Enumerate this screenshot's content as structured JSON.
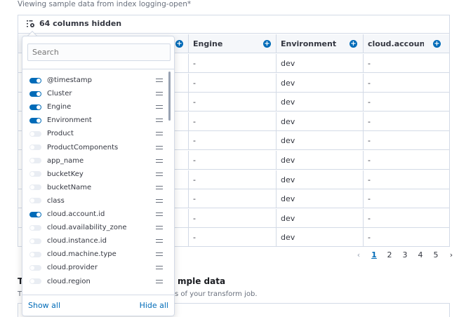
{
  "caption": "Viewing sample data from index logging-open*",
  "toolbar": {
    "columns_hidden_label": "64 columns hidden"
  },
  "grid": {
    "headers": [
      "",
      "Engine",
      "Environment",
      "cloud.accoun"
    ],
    "rows": [
      [
        "-",
        "dev",
        "-"
      ],
      [
        "-",
        "dev",
        "-"
      ],
      [
        "-",
        "dev",
        "-"
      ],
      [
        "-",
        "dev",
        "-"
      ],
      [
        "-",
        "dev",
        "-"
      ],
      [
        "-",
        "dev",
        "-"
      ],
      [
        "-",
        "dev",
        "-"
      ],
      [
        "-",
        "dev",
        "-"
      ],
      [
        "-",
        "dev",
        "-"
      ],
      [
        "-",
        "dev",
        "-"
      ]
    ]
  },
  "pagination": {
    "pages": [
      "1",
      "2",
      "3",
      "4",
      "5"
    ],
    "active": "1",
    "prev_icon": "chevron-left",
    "next_icon": "chevron-right"
  },
  "section": {
    "title_visible": "T",
    "title_tail": "mple data",
    "desc_head": "T",
    "desc_tail": "s of your transform job."
  },
  "popover": {
    "search_placeholder": "Search",
    "columns": [
      {
        "label": "@timestamp",
        "on": true
      },
      {
        "label": "Cluster",
        "on": true
      },
      {
        "label": "Engine",
        "on": true
      },
      {
        "label": "Environment",
        "on": true
      },
      {
        "label": "Product",
        "on": false
      },
      {
        "label": "ProductComponents",
        "on": false
      },
      {
        "label": "app_name",
        "on": false
      },
      {
        "label": "bucketKey",
        "on": false
      },
      {
        "label": "bucketName",
        "on": false
      },
      {
        "label": "class",
        "on": false
      },
      {
        "label": "cloud.account.id",
        "on": true
      },
      {
        "label": "cloud.availability_zone",
        "on": false
      },
      {
        "label": "cloud.instance.id",
        "on": false
      },
      {
        "label": "cloud.machine.type",
        "on": false
      },
      {
        "label": "cloud.provider",
        "on": false
      },
      {
        "label": "cloud.region",
        "on": false
      }
    ],
    "show_all": "Show all",
    "hide_all": "Hide all"
  },
  "colors": {
    "accent": "#006bb8",
    "border": "#d3dae6",
    "toggle_off": "#e9edf3"
  }
}
